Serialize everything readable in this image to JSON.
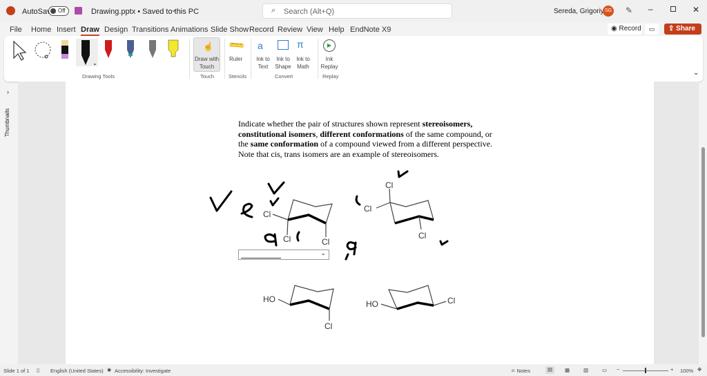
{
  "titlebar": {
    "autosave_label": "AutoSave",
    "autosave_state": "Off",
    "doc_title": "Drawing.pptx • Saved to this PC",
    "search_placeholder": "Search (Alt+Q)",
    "user_name": "Sereda, Grigoriy A",
    "user_initials": "SG"
  },
  "tabs": [
    "File",
    "Home",
    "Insert",
    "Draw",
    "Design",
    "Transitions",
    "Animations",
    "Slide Show",
    "Record",
    "Review",
    "View",
    "Help",
    "EndNote X9"
  ],
  "actions": {
    "record": "Record",
    "share": "Share"
  },
  "ribbon": {
    "drawing_tools": "Drawing Tools",
    "draw_with_touch": "Draw with Touch",
    "touch": "Touch",
    "ruler": "Ruler",
    "stencils": "Stencils",
    "ink_to_text": "Ink to Text",
    "ink_to_shape": "Ink to Shape",
    "ink_to_math": "Ink to Math",
    "convert": "Convert",
    "ink_replay": "Ink Replay",
    "replay": "Replay"
  },
  "thumbnails_label": "Thumbnails",
  "slide": {
    "q_part1": "Indicate whether the pair of structures shown represent ",
    "q_b1": "stereoisomers, constitutional isomers",
    "q_sep1": ", ",
    "q_b2": "different conformations",
    "q_part2": " of the same compound, or the ",
    "q_b3": "same conformation",
    "q_part3": " of a compound viewed from a different perspective.",
    "q_note": "Note that cis, trans isomers are an example of stereoisomers.",
    "labels": {
      "cl": "Cl",
      "ho": "HO"
    },
    "dropdown_value": ""
  },
  "colors": {
    "accent": "#c43e1c"
  },
  "status": {
    "slide": "Slide 1 of 1",
    "language": "English (United States)",
    "accessibility": "Accessibility: Investigate",
    "notes": "Notes",
    "zoom": "100%"
  }
}
